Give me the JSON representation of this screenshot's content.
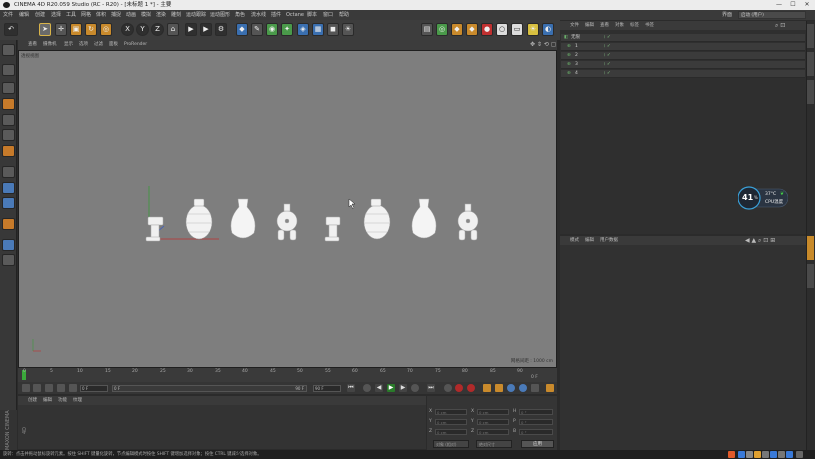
{
  "window": {
    "title": "CINEMA 4D R20.059 Studio (RC - R20) - [未标题 1 *] - 主要",
    "minimize": "—",
    "maximize": "☐",
    "close": "✕"
  },
  "menubar": {
    "items": [
      "文件",
      "编辑",
      "创建",
      "选择",
      "工具",
      "网格",
      "体积",
      "捕捉",
      "动画",
      "模拟",
      "渲染",
      "雕刻",
      "运动跟踪",
      "运动图形",
      "角色",
      "流水线",
      "插件",
      "Octane",
      "脚本",
      "窗口",
      "帮助"
    ],
    "layout_label": "界面",
    "layout_value": "启动 (用户)"
  },
  "toolbar": {
    "axis_x": "X",
    "axis_y": "Y",
    "axis_z": "Z"
  },
  "viewport": {
    "menu": [
      "查看",
      "摄像机",
      "显示",
      "选项",
      "过滤",
      "面板",
      "ProRender"
    ],
    "label": "透视视图",
    "grid_label": "网格间距 : 1000 cm"
  },
  "timeline": {
    "ticks": [
      "0",
      "5",
      "10",
      "15",
      "20",
      "25",
      "30",
      "35",
      "40",
      "45",
      "50",
      "55",
      "60",
      "65",
      "70",
      "75",
      "80",
      "85",
      "90"
    ],
    "frame_end": "0 F",
    "field_start": "0 F",
    "field_range_start": "0 F",
    "field_range_end": "90 F",
    "field_end": "90 F"
  },
  "materials": {
    "menu": [
      "创建",
      "编辑",
      "功能",
      "纹理"
    ]
  },
  "brand": "MAXON CINEMA 4D",
  "coords": {
    "rows": [
      {
        "axis": "X",
        "pos": "0 cm",
        "size": "0 cm",
        "rot_label": "H",
        "rot": "0 °"
      },
      {
        "axis": "Y",
        "pos": "0 cm",
        "size": "0 cm",
        "rot_label": "P",
        "rot": "0 °"
      },
      {
        "axis": "Z",
        "pos": "0 cm",
        "size": "0 cm",
        "rot_label": "B",
        "rot": "0 °"
      }
    ],
    "mode_object": "对象 (相对)",
    "mode_size": "绝对尺寸",
    "apply": "应用"
  },
  "object_manager": {
    "menu": [
      "文件",
      "编辑",
      "查看",
      "对象",
      "标签",
      "书签"
    ],
    "rows": [
      {
        "name": "无限",
        "indent": 0
      },
      {
        "name": "1",
        "indent": 1
      },
      {
        "name": "2",
        "indent": 1
      },
      {
        "name": "3",
        "indent": 1
      },
      {
        "name": "4",
        "indent": 1
      }
    ]
  },
  "attribute_manager": {
    "menu": [
      "模式",
      "编辑",
      "用户数据"
    ]
  },
  "cpu_widget": {
    "percent": "41",
    "unit": "%",
    "temp": "37°C",
    "label": "CPU温度"
  },
  "statusbar": {
    "text": "旋转：点击并拖动鼠标旋转元素。按住 SHIFT 键量化旋转，节点编辑模式时按住 SHIFT 键增加选择对象；按住 CTRL 键减少选择对象。"
  },
  "colors": {
    "accent_orange": "#c98a2c",
    "accent_blue": "#3a6fb0",
    "viewport_bg": "#7e7e7e"
  }
}
